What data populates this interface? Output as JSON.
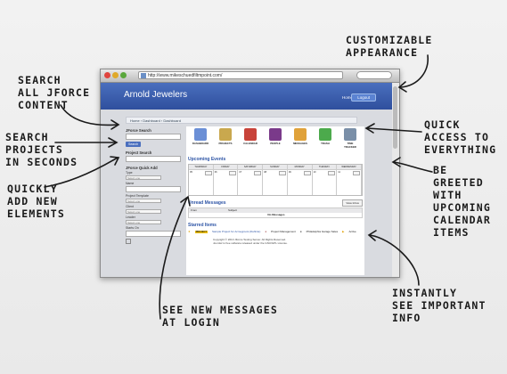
{
  "annotations": {
    "customizable": [
      "CUSTOMIZABLE",
      "APPEARANCE"
    ],
    "search_all": [
      "SEARCH",
      "ALL JFORCE",
      "CONTENT"
    ],
    "search_projects": [
      "SEARCH",
      "PROJECTS",
      "IN SECONDS"
    ],
    "quickly_add": [
      "QUICKLY",
      "ADD NEW",
      "ELEMENTS"
    ],
    "quick_access": [
      "QUICK",
      "ACCESS TO",
      "EVERYTHING"
    ],
    "greeted": [
      "BE",
      "GREETED",
      "WITH",
      "UPCOMING",
      "CALENDAR",
      "ITEMS"
    ],
    "new_messages": [
      "SEE NEW MESSAGES",
      "AT LOGIN"
    ],
    "important_info": [
      "INSTANTLY",
      "SEE IMPORTANT",
      "INFO"
    ]
  },
  "browser": {
    "url": "http://www.mikeschuedfiltmpoint.com/"
  },
  "header": {
    "title": "Arnold Jewelers",
    "home_label": "Home",
    "logout_label": "Logout"
  },
  "breadcrumb": "Home › Dashboard › Dashboard",
  "sidebar": {
    "jforce_search": "JForce Search",
    "search_button": "Search",
    "project_search": "Project Search",
    "quick_add": "JForce Quick Add",
    "type_label": "Type",
    "select_one": "Select one",
    "name_label": "Name",
    "project_template": "Project Template",
    "client_label": "Client",
    "leader_label": "Leader",
    "starts_on": "Starts On"
  },
  "toolbar": [
    {
      "label": "DASHBOARD",
      "icon": "monitor-icon",
      "color": "#6b8fd6"
    },
    {
      "label": "PROJECTS",
      "icon": "clipboard-icon",
      "color": "#c9a84e"
    },
    {
      "label": "CALENDAR",
      "icon": "calendar-icon",
      "color": "#c8433a"
    },
    {
      "label": "PEOPLE",
      "icon": "book-icon",
      "color": "#7a3a8a"
    },
    {
      "label": "MESSAGES",
      "icon": "envelope-icon",
      "color": "#e0a23a"
    },
    {
      "label": "TRASH",
      "icon": "trash-icon",
      "color": "#4caa4c"
    },
    {
      "label": "TIME TRACKER",
      "icon": "clock-icon",
      "color": "#7a8fa8"
    }
  ],
  "upcoming": {
    "title": "Upcoming Events",
    "days": [
      "THURSDAY",
      "FRIDAY",
      "SATURDAY",
      "SUNDAY",
      "MONDAY",
      "TUESDAY",
      "WEDNESDAY"
    ],
    "dates": [
      "05",
      "06",
      "07",
      "08",
      "09",
      "10",
      "11"
    ]
  },
  "messages": {
    "title": "Unread Messages",
    "view_inbox": "View Inbox",
    "col_from": "From",
    "col_subject": "Subject",
    "empty": "No Messages"
  },
  "starred": {
    "title": "Starred Items",
    "badge": "PROJECT",
    "item1": "Sample Project for Acmegroots (Definite)",
    "item2": "Project Management",
    "item3": "Philadelphia Garage Sales",
    "item4": "Active"
  },
  "footer": {
    "line1": "Copyright © 2010 JForce Testing Server. All Rights Reserved.",
    "line2": "Joomla! is free software released under the GNU/GPL License."
  }
}
